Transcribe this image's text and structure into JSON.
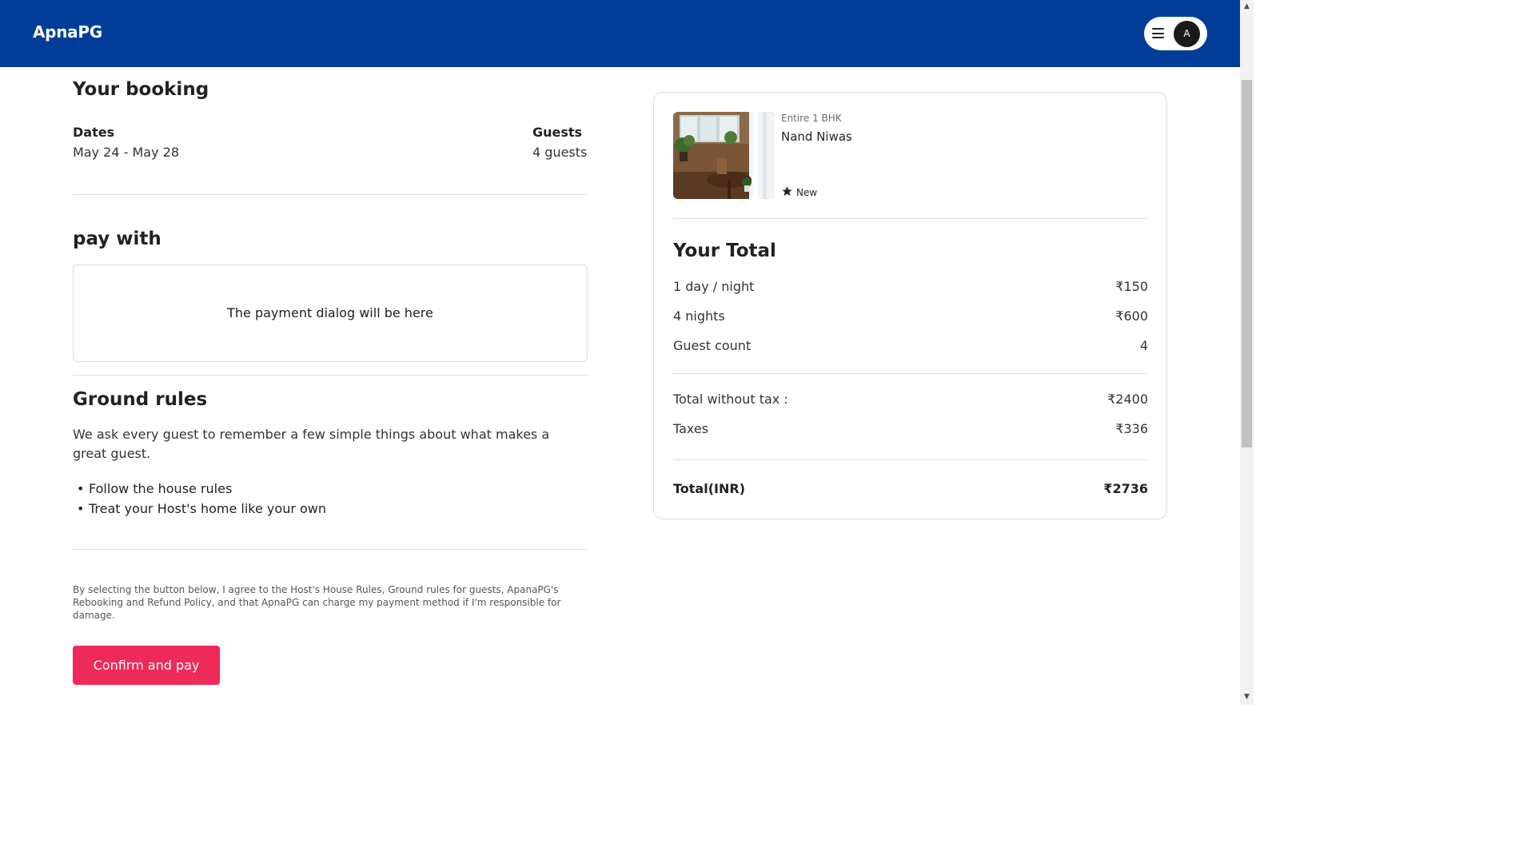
{
  "header": {
    "logo": "ApnaPG",
    "avatar_initial": "A",
    "bg_color": "#003d99"
  },
  "booking": {
    "title": "Your booking",
    "dates_label": "Dates",
    "dates_value": "May 24 - May 28",
    "guests_label": "Guests",
    "guests_value": "4 guests"
  },
  "payment": {
    "title": "pay with",
    "dialog_placeholder": "The payment dialog will be here"
  },
  "rules": {
    "title": "Ground rules",
    "description": "We ask every guest to remember a few simple things about what makes a great guest.",
    "items": [
      "Follow the house rules",
      "Treat your Host's home like your own"
    ]
  },
  "agreement": "By selecting the button below, I agree to the Host's House Rules, Ground rules for guests, ApanaPG's Rebooking and Refund Policy, and that ApnaPG can charge my payment method if I'm responsible for damage.",
  "confirm_button": {
    "label": "Confirm and pay",
    "color": "#ee2a59"
  },
  "summary": {
    "property_type": "Entire 1 BHK",
    "property_name": "Nand Niwas",
    "rating_label": "New",
    "total_title": "Your Total",
    "rows": [
      {
        "label": "1 day / night",
        "value": "₹150"
      },
      {
        "label": "4 nights",
        "value": "₹600"
      },
      {
        "label": "Guest count",
        "value": "4"
      }
    ],
    "tax_rows": [
      {
        "label": "Total without tax :",
        "value": "₹2400"
      },
      {
        "label": "Taxes",
        "value": "₹336"
      }
    ],
    "grand_total": {
      "label": "Total(INR)",
      "value": "₹2736"
    }
  }
}
